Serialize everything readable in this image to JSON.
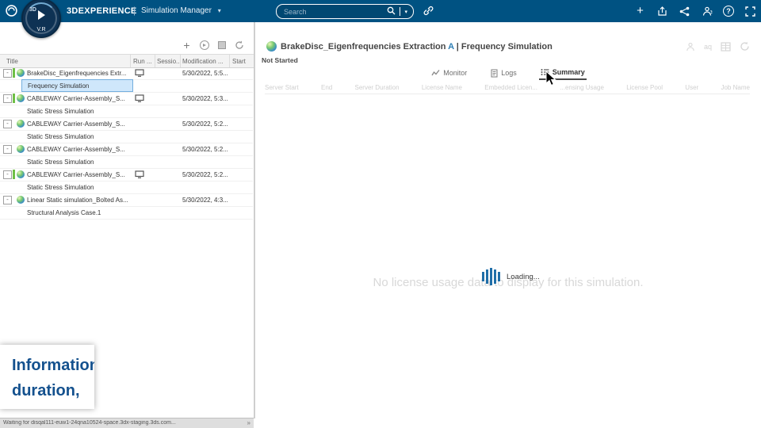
{
  "topbar": {
    "brand": "3DEXPERIENCE",
    "brand_sep": "|",
    "app_menu": "Simulation Manager",
    "search_placeholder": "Search",
    "badge": {
      "top": "3D",
      "bottom": "V.R"
    }
  },
  "icons": {
    "plus": "+",
    "minus": "-",
    "help": "?",
    "caret": "▾",
    "translate": "aq",
    "chevrons": "»"
  },
  "left_panel": {
    "columns": [
      "Title",
      "Run ...",
      "Sessio...",
      "Modification ...",
      "Start"
    ],
    "rows": [
      {
        "title": "BrakeDisc_Eigenfrequencies Extr...",
        "date": "5/30/2022, 5:5..."
      },
      {
        "title": "Frequency Simulation"
      },
      {
        "title": "CABLEWAY Carrier-Assembly_S...",
        "date": "5/30/2022, 5:3..."
      },
      {
        "title": "Static Stress Simulation"
      },
      {
        "title": "CABLEWAY Carrier-Assembly_S...",
        "date": "5/30/2022, 5:2..."
      },
      {
        "title": "Static Stress Simulation"
      },
      {
        "title": "CABLEWAY Carrier-Assembly_S...",
        "date": "5/30/2022, 5:2..."
      },
      {
        "title": "Static Stress Simulation"
      },
      {
        "title": "CABLEWAY Carrier-Assembly_S...",
        "date": "5/30/2022, 5:2..."
      },
      {
        "title": "Static Stress Simulation"
      },
      {
        "title": "Linear Static simulation_Bolted As...",
        "date": "5/30/2022, 4:3..."
      },
      {
        "title": "Structural Analysis Case.1"
      }
    ],
    "status_text": "Waiting for disqal111-euw1-24qna10524-space.3dx-staging.3ds.com...",
    "popup": {
      "line1": "Information",
      "line2": "duration,"
    }
  },
  "main": {
    "title": "BrakeDisc_Eigenfrequencies Extraction",
    "revision": "A",
    "sep": "|",
    "subtitle": "Frequency Simulation",
    "status": "Not Started",
    "tabs": [
      "Monitor",
      "Logs",
      "Summary"
    ],
    "columns": [
      "Server Start",
      "End",
      "Server Duration",
      "License Name",
      "Embedded Licen...",
      "...ensing Usage",
      "License Pool",
      "User",
      "Job Name"
    ],
    "loading": "Loading...",
    "empty": "No license usage data to display for this simulation."
  }
}
